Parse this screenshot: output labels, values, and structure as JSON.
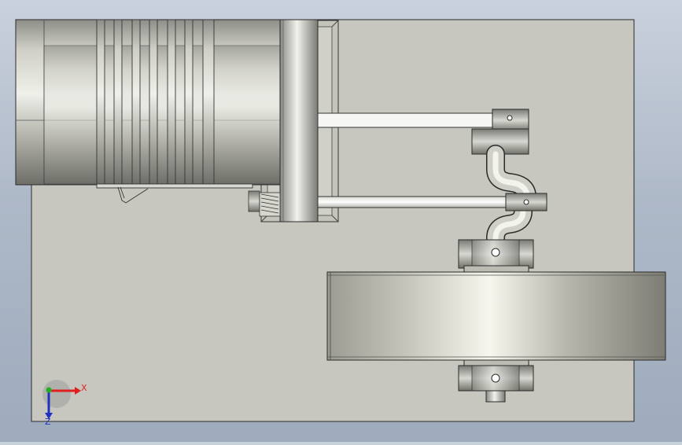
{
  "view": {
    "type": "CAD orthographic front view",
    "background_colors": [
      "#c9d1dc",
      "#9eabbd"
    ],
    "part_color": "#c7c7c0"
  },
  "triad": {
    "x_label": "X",
    "z_label": "Z",
    "x_color": "#e02020",
    "y_color": "#20b020",
    "z_color": "#2030c0"
  }
}
